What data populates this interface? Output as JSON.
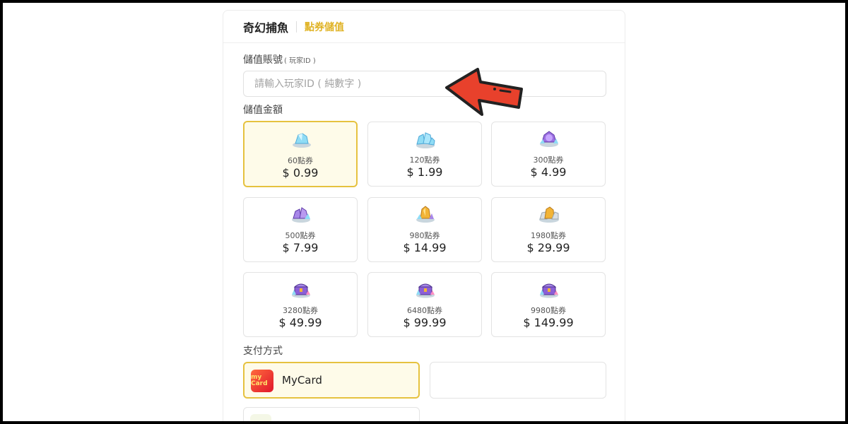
{
  "header": {
    "game_title": "奇幻捕魚",
    "section": "點券儲值"
  },
  "account": {
    "label": "儲值賬號",
    "label_hint": "( 玩家ID )",
    "placeholder": "請輸入玩家ID ( 純數字 )"
  },
  "amount": {
    "label": "儲值金額",
    "packages": [
      {
        "name": "60點券",
        "price": "$ 0.99",
        "icon": "crystal-small-icon",
        "selected": true
      },
      {
        "name": "120點券",
        "price": "$ 1.99",
        "icon": "crystal-cluster-icon",
        "selected": false
      },
      {
        "name": "300點券",
        "price": "$ 4.99",
        "icon": "purple-gem-icon",
        "selected": false
      },
      {
        "name": "500點券",
        "price": "$ 7.99",
        "icon": "purple-crystal-icon",
        "selected": false
      },
      {
        "name": "980點券",
        "price": "$ 14.99",
        "icon": "gold-crystal-icon",
        "selected": false
      },
      {
        "name": "1980點券",
        "price": "$ 29.99",
        "icon": "gold-crystal-pile-icon",
        "selected": false
      },
      {
        "name": "3280點券",
        "price": "$ 49.99",
        "icon": "treasure-chest-icon",
        "selected": false
      },
      {
        "name": "6480點券",
        "price": "$ 99.99",
        "icon": "treasure-chest-icon",
        "selected": false
      },
      {
        "name": "9980點券",
        "price": "$ 149.99",
        "icon": "treasure-chest-icon",
        "selected": false
      }
    ]
  },
  "payment": {
    "label": "支付方式",
    "methods": [
      {
        "name": "MyCard",
        "logo_text": "my Card",
        "selected": true
      }
    ]
  },
  "colors": {
    "accent": "#e6c23f",
    "selected_bg": "#fefbe9",
    "arrow_red": "#e8412c"
  }
}
